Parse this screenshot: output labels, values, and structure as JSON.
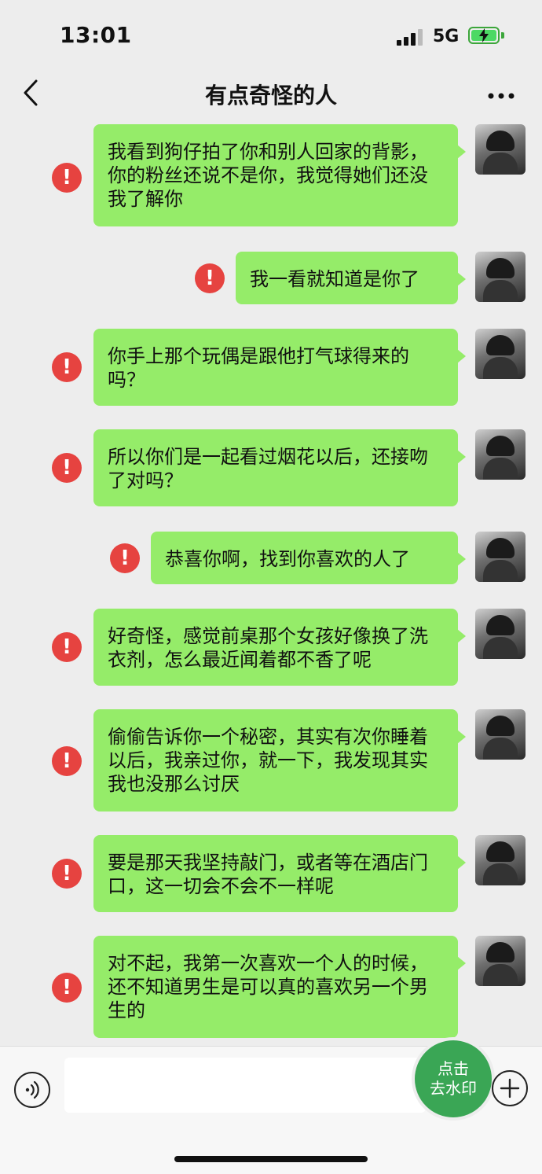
{
  "status": {
    "time": "13:01",
    "network": "5G",
    "signal_icon": "signal-bars-icon",
    "battery_icon": "battery-charging-icon",
    "battery_color": "#4cd964"
  },
  "header": {
    "title": "有点奇怪的人",
    "back_icon": "chevron-left-icon",
    "more_icon": "more-dots-icon"
  },
  "colors": {
    "bubble": "#95ec69",
    "error": "#e64340",
    "background": "#ededed",
    "watermark_button": "#3aa655"
  },
  "messages": [
    {
      "text": "我看到狗仔拍了你和别人回家的背影，你的粉丝还说不是你，我觉得她们还没我了解你",
      "status_icon": "!"
    },
    {
      "text": "我一看就知道是你了",
      "status_icon": "!"
    },
    {
      "text": "你手上那个玩偶是跟他打气球得来的吗？",
      "status_icon": "!"
    },
    {
      "text": "所以你们是一起看过烟花以后，还接吻了对吗？",
      "status_icon": "!"
    },
    {
      "text": "恭喜你啊，找到你喜欢的人了",
      "status_icon": "!"
    },
    {
      "text": "好奇怪，感觉前桌那个女孩好像换了洗衣剂，怎么最近闻着都不香了呢",
      "status_icon": "!"
    },
    {
      "text": "偷偷告诉你一个秘密，其实有次你睡着以后，我亲过你，就一下，我发现其实我也没那么讨厌",
      "status_icon": "!"
    },
    {
      "text": "要是那天我坚持敲门，或者等在酒店门口，这一切会不会不一样呢",
      "status_icon": "!"
    },
    {
      "text": "对不起，我第一次喜欢一个人的时候，还不知道男生是可以真的喜欢另一个男生的",
      "status_icon": "!"
    }
  ],
  "input_bar": {
    "voice_icon": "voice-icon",
    "plus_icon": "plus-icon",
    "watermark_line1": "点击",
    "watermark_line2": "去水印"
  }
}
